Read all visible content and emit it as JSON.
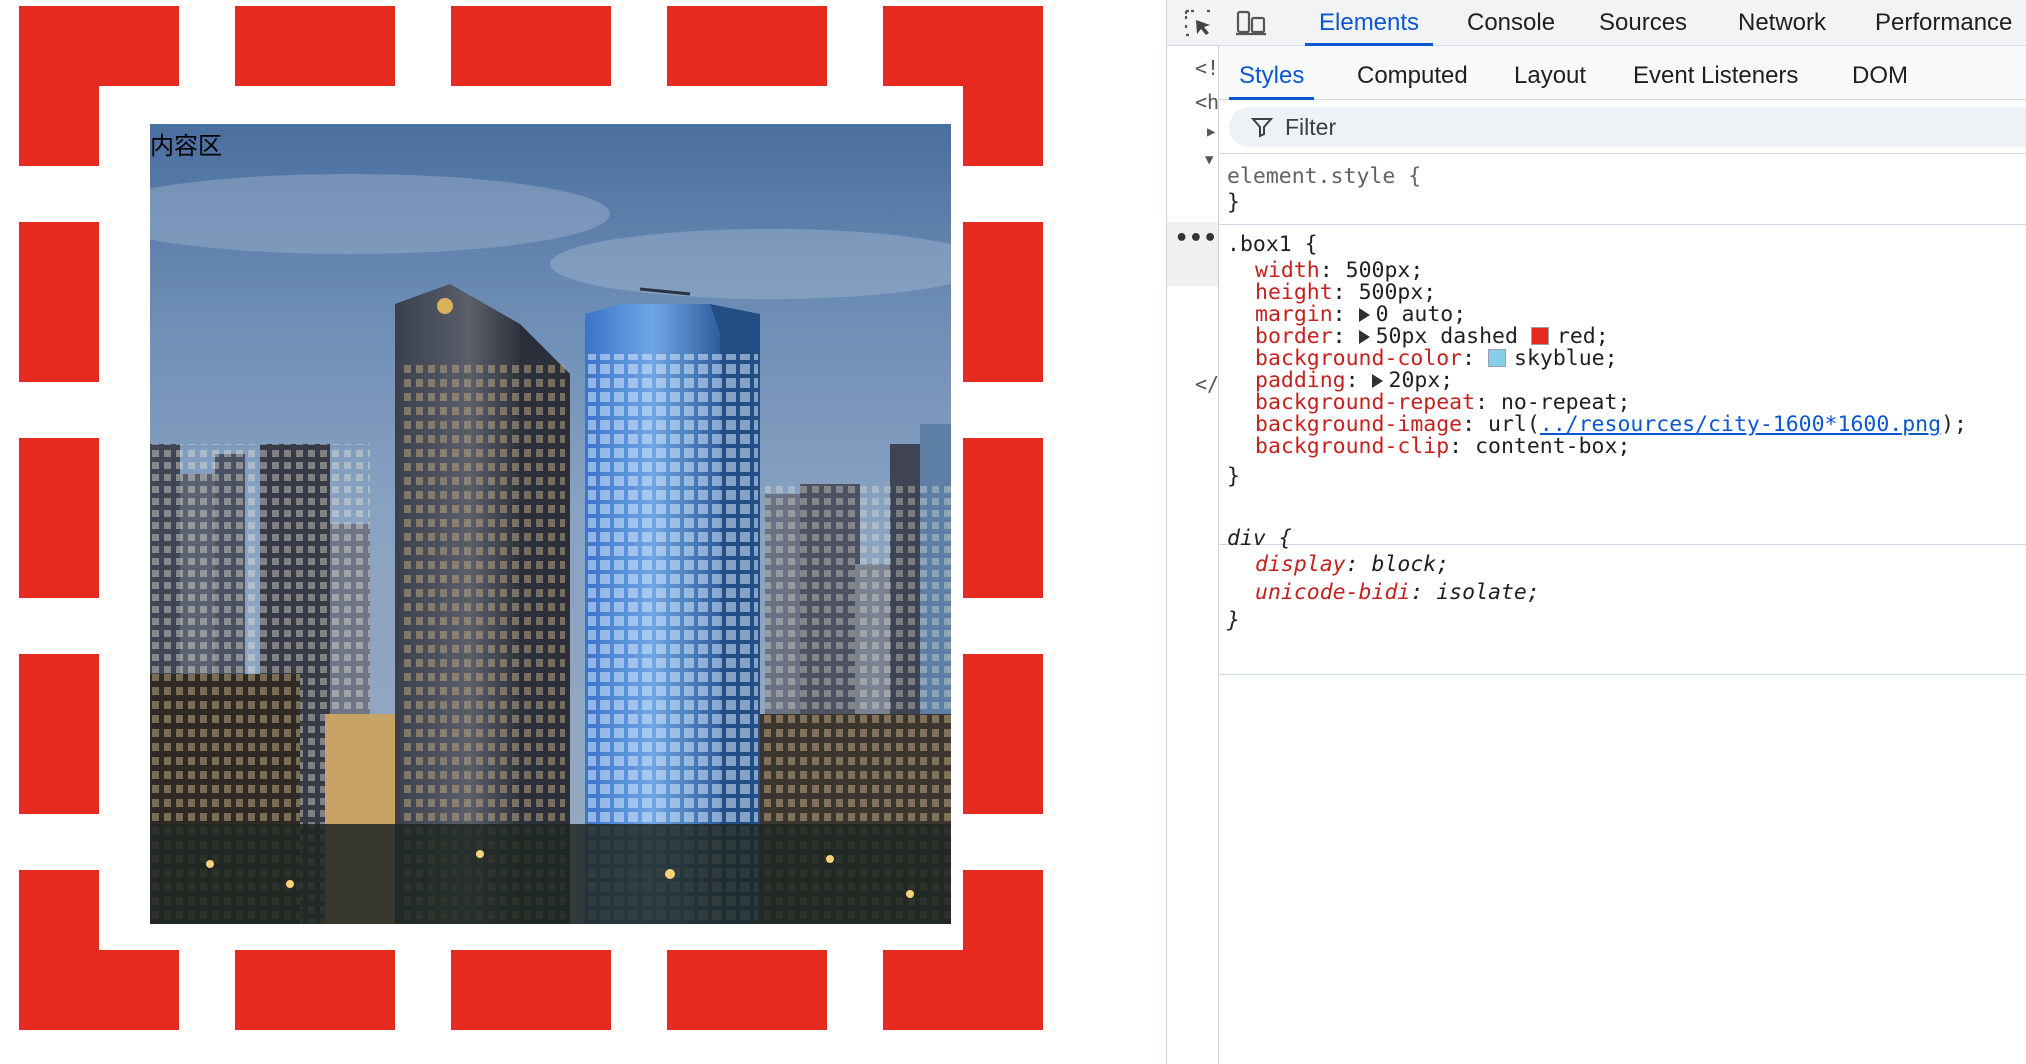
{
  "page": {
    "content_label": "内容区",
    "border_color": "#e62a20"
  },
  "devtools": {
    "main_tabs": [
      "Elements",
      "Console",
      "Sources",
      "Network",
      "Performance"
    ],
    "active_main_tab": "Elements",
    "sub_tabs": [
      "Styles",
      "Computed",
      "Layout",
      "Event Listeners",
      "DOM Breakpoints"
    ],
    "active_sub_tab": "Styles",
    "filter_placeholder": "Filter",
    "gutter_fragments": [
      "<!",
      "<h",
      "</"
    ],
    "gutter_more": "•••",
    "rules": {
      "element_style": {
        "selector": "element.style {",
        "close": "}"
      },
      "box1": {
        "selector": ".box1 {",
        "close": "}",
        "props": [
          {
            "name": "width",
            "value": "500px;"
          },
          {
            "name": "height",
            "value": "500px;"
          },
          {
            "name": "margin",
            "value": "0 auto;"
          },
          {
            "name": "border",
            "value_pre": "50px dashed",
            "value_post": "red;"
          },
          {
            "name": "background-color",
            "value": "skyblue;"
          },
          {
            "name": "padding",
            "value": "20px;"
          },
          {
            "name": "background-repeat",
            "value": "no-repeat;"
          },
          {
            "name": "background-image",
            "value_pre": "url(",
            "link": "../resources/city-1600*1600.png",
            "value_post": ");"
          },
          {
            "name": "background-clip",
            "value": "content-box;"
          }
        ]
      },
      "div": {
        "selector": "div {",
        "close": "}",
        "props": [
          {
            "name": "display",
            "value": "block;"
          },
          {
            "name": "unicode-bidi",
            "value": "isolate;"
          }
        ]
      }
    },
    "colors": {
      "red_swatch": "#e62a20",
      "skyblue_swatch": "#87ceeb",
      "accent": "#0b57d0"
    }
  }
}
